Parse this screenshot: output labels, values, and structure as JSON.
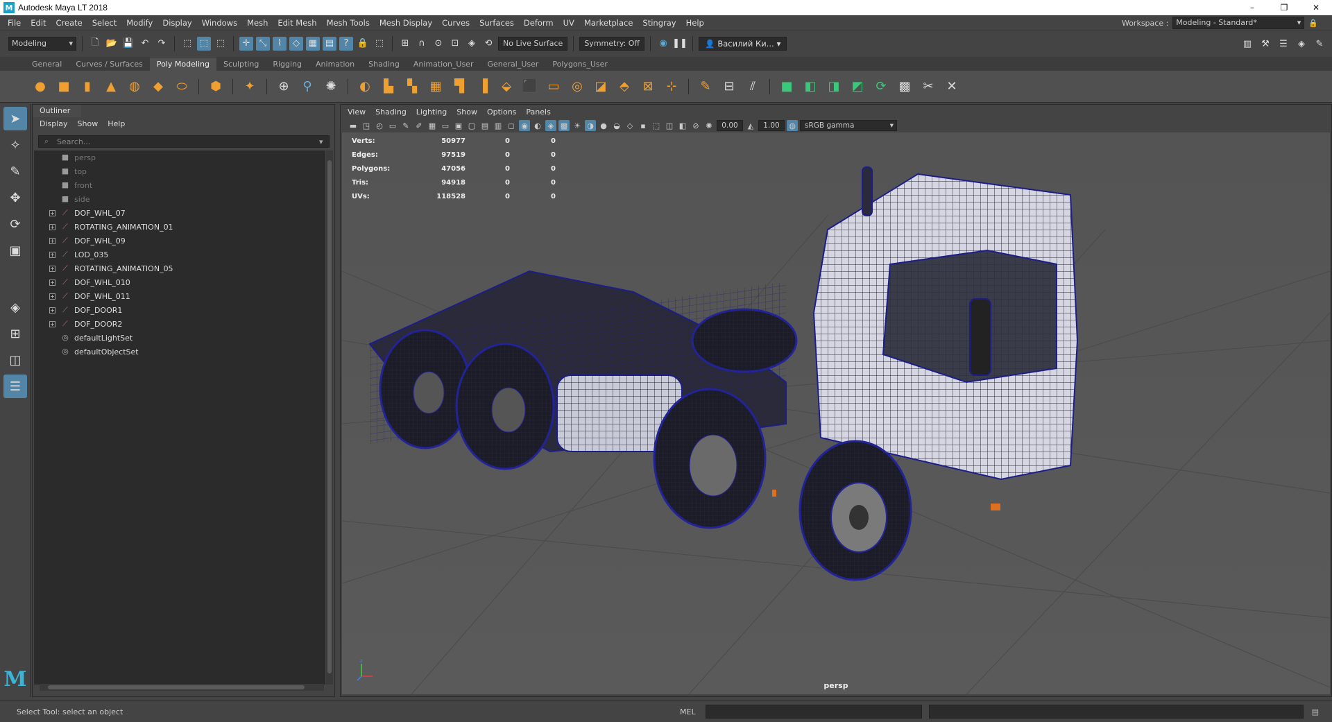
{
  "window": {
    "title": "Autodesk Maya LT 2018",
    "controls": [
      "–",
      "❐",
      "✕"
    ]
  },
  "menu": {
    "items": [
      "File",
      "Edit",
      "Create",
      "Select",
      "Modify",
      "Display",
      "Windows",
      "Mesh",
      "Edit Mesh",
      "Mesh Tools",
      "Mesh Display",
      "Curves",
      "Surfaces",
      "Deform",
      "UV",
      "Marketplace",
      "Stingray",
      "Help"
    ],
    "workspace_label": "Workspace :",
    "workspace_value": "Modeling - Standard*"
  },
  "statusline": {
    "mode": "Modeling",
    "live_surface": "No Live Surface",
    "symmetry": "Symmetry: Off",
    "user": "Василий Ки..."
  },
  "shelf": {
    "tabs": [
      "General",
      "Curves / Surfaces",
      "Poly Modeling",
      "Sculpting",
      "Rigging",
      "Animation",
      "Shading",
      "Animation_User",
      "General_User",
      "Polygons_User"
    ],
    "active_tab": "Poly Modeling"
  },
  "outliner": {
    "title": "Outliner",
    "menu": [
      "Display",
      "Show",
      "Help"
    ],
    "search_placeholder": "Search...",
    "items": [
      {
        "label": "persp",
        "kind": "camera"
      },
      {
        "label": "top",
        "kind": "camera"
      },
      {
        "label": "front",
        "kind": "camera"
      },
      {
        "label": "side",
        "kind": "camera"
      },
      {
        "label": "DOF_WHL_07",
        "kind": "transform"
      },
      {
        "label": "ROTATING_ANIMATION_01",
        "kind": "transform"
      },
      {
        "label": "DOF_WHL_09",
        "kind": "transform"
      },
      {
        "label": "LOD_035",
        "kind": "transform"
      },
      {
        "label": "ROTATING_ANIMATION_05",
        "kind": "transform"
      },
      {
        "label": "DOF_WHL_010",
        "kind": "transform"
      },
      {
        "label": "DOF_WHL_011",
        "kind": "transform"
      },
      {
        "label": "DOF_DOOR1",
        "kind": "transform"
      },
      {
        "label": "DOF_DOOR2",
        "kind": "transform"
      },
      {
        "label": "defaultLightSet",
        "kind": "set"
      },
      {
        "label": "defaultObjectSet",
        "kind": "set"
      }
    ]
  },
  "viewport": {
    "menu": [
      "View",
      "Shading",
      "Lighting",
      "Show",
      "Options",
      "Panels"
    ],
    "near_value": "0.00",
    "far_value": "1.00",
    "color_management": "sRGB gamma",
    "camera": "persp",
    "hud": [
      {
        "key": "Verts:",
        "v1": "50977",
        "v2": "0",
        "v3": "0"
      },
      {
        "key": "Edges:",
        "v1": "97519",
        "v2": "0",
        "v3": "0"
      },
      {
        "key": "Polygons:",
        "v1": "47056",
        "v2": "0",
        "v3": "0"
      },
      {
        "key": "Tris:",
        "v1": "94918",
        "v2": "0",
        "v3": "0"
      },
      {
        "key": "UVs:",
        "v1": "118528",
        "v2": "0",
        "v3": "0"
      }
    ]
  },
  "bottom": {
    "help_text": "Select Tool: select an object",
    "mel_label": "MEL"
  }
}
